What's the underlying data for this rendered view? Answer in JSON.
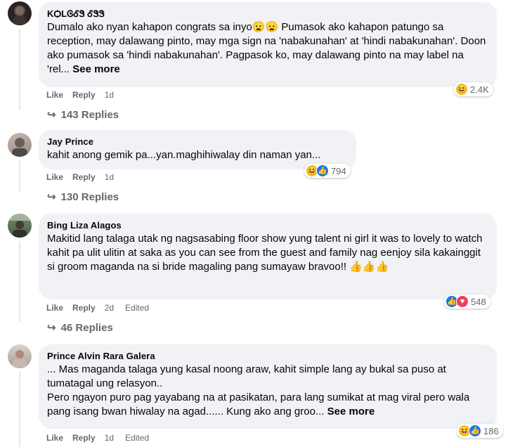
{
  "comments": [
    {
      "author": "KѺLᎶᎴᏕ ᎴᏕᏕ",
      "text": "Dumalo ako nyan kahapon congrats sa inyo😦😦 Pumasok ako kahapon patungo sa reception, may dalawang pinto, may mga sign na 'nabakunahan' at 'hindi nabakunahan'. Doon ako pumasok sa 'hindi nabakunahan'. Pagpasok ko, may dalawang pinto na may label na 'rel...",
      "see_more": "See more",
      "like": "Like",
      "reply": "Reply",
      "time": "1d",
      "edited": "",
      "reactions": [
        "haha"
      ],
      "reaction_count": "2.4K",
      "replies": "143 Replies"
    },
    {
      "author": "Jay Prince",
      "text": "kahit anong gemik pa...yan.maghihiwalay din naman yan...",
      "see_more": "",
      "like": "Like",
      "reply": "Reply",
      "time": "1d",
      "edited": "",
      "reactions": [
        "haha",
        "like"
      ],
      "reaction_count": "794",
      "replies": "130 Replies"
    },
    {
      "author": "Bing Liza Alagos",
      "text": "Makitid lang talaga utak ng nagsasabing floor show yung talent ni girl it was to lovely to watch kahit pa ulit ulitin at saka as you can see from the guest and family nag eenjoy sila kakainggit si groom maganda na si bride magaling pang sumayaw bravoo!! 👍👍👍",
      "see_more": "",
      "like": "Like",
      "reply": "Reply",
      "time": "2d",
      "edited": "Edited",
      "reactions": [
        "like",
        "love"
      ],
      "reaction_count": "548",
      "replies": "46 Replies"
    },
    {
      "author": "Prince Alvin Rara Galera",
      "text": "... Mas maganda talaga yung kasal noong araw, kahit simple lang ay bukal sa puso at tumatagal ung relasyon..\nPero ngayon puro pag yayabang na at pasikatan, para lang sumikat at mag viral pero wala pang isang bwan hiwalay na agad...... Kung ako ang groo...",
      "see_more": "See more",
      "like": "Like",
      "reply": "Reply",
      "time": "1d",
      "edited": "Edited",
      "reactions": [
        "haha",
        "like"
      ],
      "reaction_count": "186",
      "replies": ""
    }
  ],
  "reaction_icons": {
    "haha": "😆",
    "like": "👍",
    "love": "♥"
  },
  "reply_arrow": "↪",
  "colors": {
    "bubble": "#f0f2f5",
    "meta": "#65676b",
    "like_blue": "#1877f2",
    "love_red": "#f33e58",
    "haha_yellow": "#f7b928"
  }
}
